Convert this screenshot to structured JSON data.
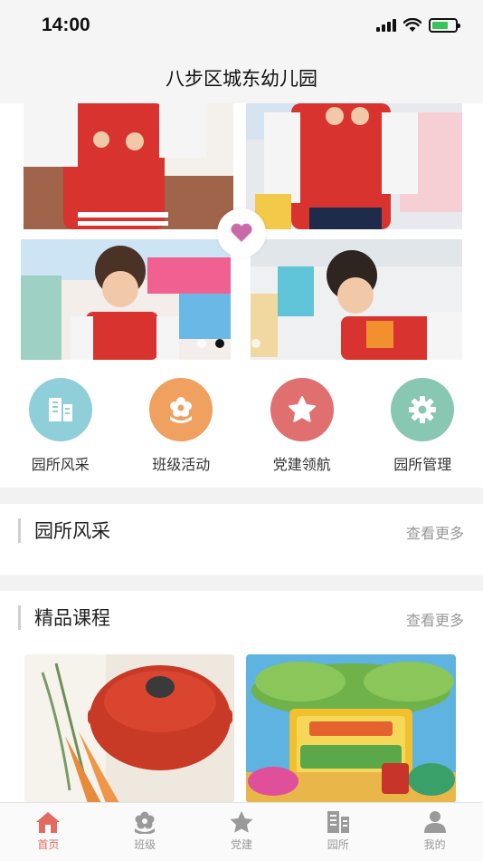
{
  "status_bar": {
    "time": "14:00",
    "battery_percent": 70
  },
  "nav": {
    "title": "八步区城东幼儿园"
  },
  "banner": {
    "slide_count": 4,
    "active_slide": 1
  },
  "quick_menu": [
    {
      "label": "园所风采",
      "icon": "building-icon",
      "color": "#8fcfda"
    },
    {
      "label": "班级活动",
      "icon": "flower-icon",
      "color": "#f0a05f"
    },
    {
      "label": "党建领航",
      "icon": "star-icon",
      "color": "#e06f70"
    },
    {
      "label": "园所管理",
      "icon": "gear-icon",
      "color": "#88c7b2"
    }
  ],
  "sections": {
    "campus": {
      "title": "园所风采",
      "more": "查看更多"
    },
    "courses": {
      "title": "精品课程",
      "more": "查看更多"
    }
  },
  "tab_bar": [
    {
      "label": "首页",
      "icon": "home-icon",
      "active": true
    },
    {
      "label": "班级",
      "icon": "flower-icon",
      "active": false
    },
    {
      "label": "党建",
      "icon": "star-icon",
      "active": false
    },
    {
      "label": "园所",
      "icon": "building-icon",
      "active": false
    },
    {
      "label": "我的",
      "icon": "user-icon",
      "active": false
    }
  ],
  "colors": {
    "accent": "#e26b5f",
    "inactive": "#9a9a9a",
    "background": "#f2f2f2"
  }
}
